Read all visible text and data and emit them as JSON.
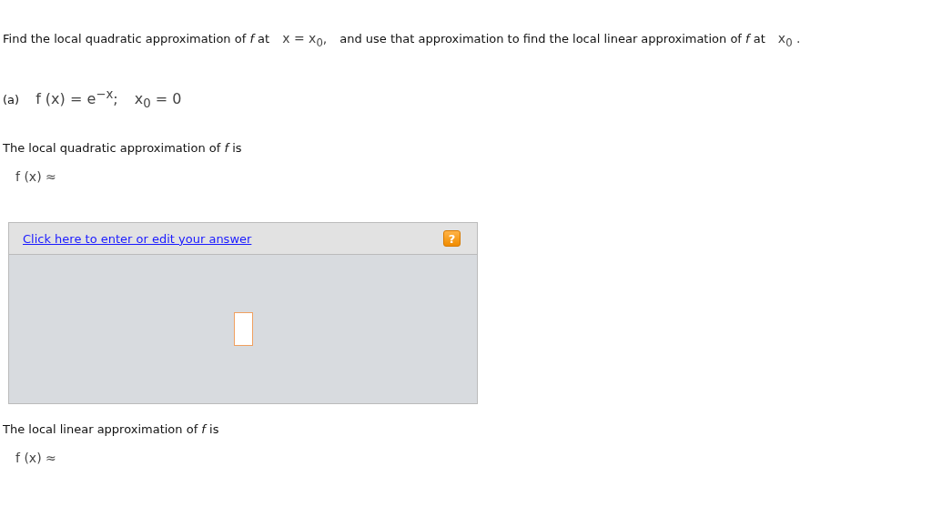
{
  "intro": [
    {
      "kind": "text",
      "text": "Find the local quadratic approximation of *f* at"
    },
    {
      "kind": "math",
      "text": "x = x$_{0}$,"
    },
    {
      "kind": "text",
      "text": "and use that approximation to find the local linear approximation of *f* at"
    },
    {
      "kind": "math",
      "text": "x$_{0}$ ."
    }
  ],
  "part": {
    "label": "(a)",
    "function": "f (x) = e$^{−x}$;",
    "point": "x$_{0}$ = 0"
  },
  "quadratic": {
    "prompt": "The local quadratic approximation of *f* is",
    "lhs": "f (x) ≈"
  },
  "answer_panel": {
    "link": "Click here to enter or edit your answer",
    "help": "?"
  },
  "linear": {
    "prompt": "The local linear approximation of *f* is",
    "lhs": "f (x) ≈"
  }
}
